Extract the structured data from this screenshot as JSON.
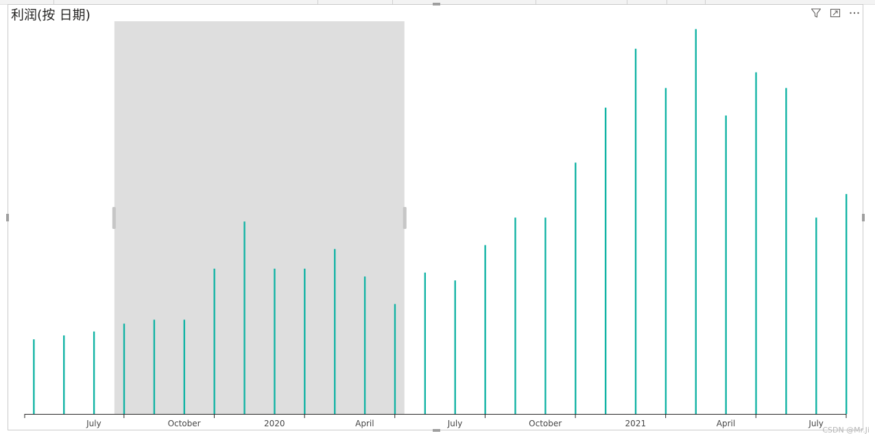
{
  "visual": {
    "title": "利润(按 日期)",
    "watermark": "CSDN @Mr.Ji",
    "header_icons": [
      "filter-icon",
      "focus-mode-icon",
      "more-options-icon"
    ]
  },
  "chart_data": {
    "type": "bar",
    "title": "利润(按 日期)",
    "xlabel": "",
    "ylabel": "",
    "bar_color": "#11b3a4",
    "selection_color": "#dedede",
    "grid": false,
    "legend": "none",
    "x_start_month": "2019-06",
    "xlim_months": [
      -0.3,
      27
    ],
    "ylim": [
      0,
      100
    ],
    "selected_range_months": [
      3,
      12
    ],
    "values": [
      19,
      20,
      21,
      23,
      24,
      24,
      37,
      49,
      37,
      37,
      42,
      35,
      28,
      36,
      34,
      43,
      50,
      50,
      64,
      78,
      93,
      83,
      98,
      76,
      87,
      83,
      50,
      56
    ],
    "x_ticks": [
      {
        "month": 2,
        "label": "July"
      },
      {
        "month": 5,
        "label": "October"
      },
      {
        "month": 8,
        "label": "2020"
      },
      {
        "month": 11,
        "label": "April"
      },
      {
        "month": 14,
        "label": "July"
      },
      {
        "month": 17,
        "label": "October"
      },
      {
        "month": 20,
        "label": "2021"
      },
      {
        "month": 23,
        "label": "April"
      },
      {
        "month": 26,
        "label": "July"
      }
    ]
  }
}
